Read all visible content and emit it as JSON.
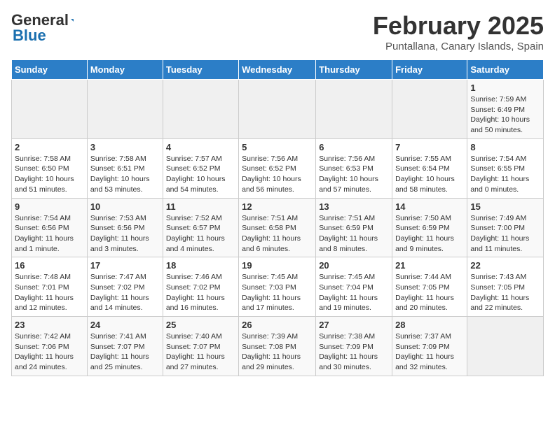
{
  "header": {
    "logo_general": "General",
    "logo_blue": "Blue",
    "month_title": "February 2025",
    "location": "Puntallana, Canary Islands, Spain"
  },
  "days_of_week": [
    "Sunday",
    "Monday",
    "Tuesday",
    "Wednesday",
    "Thursday",
    "Friday",
    "Saturday"
  ],
  "weeks": [
    [
      {
        "day": "",
        "text": ""
      },
      {
        "day": "",
        "text": ""
      },
      {
        "day": "",
        "text": ""
      },
      {
        "day": "",
        "text": ""
      },
      {
        "day": "",
        "text": ""
      },
      {
        "day": "",
        "text": ""
      },
      {
        "day": "1",
        "text": "Sunrise: 7:59 AM\nSunset: 6:49 PM\nDaylight: 10 hours and 50 minutes."
      }
    ],
    [
      {
        "day": "2",
        "text": "Sunrise: 7:58 AM\nSunset: 6:50 PM\nDaylight: 10 hours and 51 minutes."
      },
      {
        "day": "3",
        "text": "Sunrise: 7:58 AM\nSunset: 6:51 PM\nDaylight: 10 hours and 53 minutes."
      },
      {
        "day": "4",
        "text": "Sunrise: 7:57 AM\nSunset: 6:52 PM\nDaylight: 10 hours and 54 minutes."
      },
      {
        "day": "5",
        "text": "Sunrise: 7:56 AM\nSunset: 6:52 PM\nDaylight: 10 hours and 56 minutes."
      },
      {
        "day": "6",
        "text": "Sunrise: 7:56 AM\nSunset: 6:53 PM\nDaylight: 10 hours and 57 minutes."
      },
      {
        "day": "7",
        "text": "Sunrise: 7:55 AM\nSunset: 6:54 PM\nDaylight: 10 hours and 58 minutes."
      },
      {
        "day": "8",
        "text": "Sunrise: 7:54 AM\nSunset: 6:55 PM\nDaylight: 11 hours and 0 minutes."
      }
    ],
    [
      {
        "day": "9",
        "text": "Sunrise: 7:54 AM\nSunset: 6:56 PM\nDaylight: 11 hours and 1 minute."
      },
      {
        "day": "10",
        "text": "Sunrise: 7:53 AM\nSunset: 6:56 PM\nDaylight: 11 hours and 3 minutes."
      },
      {
        "day": "11",
        "text": "Sunrise: 7:52 AM\nSunset: 6:57 PM\nDaylight: 11 hours and 4 minutes."
      },
      {
        "day": "12",
        "text": "Sunrise: 7:51 AM\nSunset: 6:58 PM\nDaylight: 11 hours and 6 minutes."
      },
      {
        "day": "13",
        "text": "Sunrise: 7:51 AM\nSunset: 6:59 PM\nDaylight: 11 hours and 8 minutes."
      },
      {
        "day": "14",
        "text": "Sunrise: 7:50 AM\nSunset: 6:59 PM\nDaylight: 11 hours and 9 minutes."
      },
      {
        "day": "15",
        "text": "Sunrise: 7:49 AM\nSunset: 7:00 PM\nDaylight: 11 hours and 11 minutes."
      }
    ],
    [
      {
        "day": "16",
        "text": "Sunrise: 7:48 AM\nSunset: 7:01 PM\nDaylight: 11 hours and 12 minutes."
      },
      {
        "day": "17",
        "text": "Sunrise: 7:47 AM\nSunset: 7:02 PM\nDaylight: 11 hours and 14 minutes."
      },
      {
        "day": "18",
        "text": "Sunrise: 7:46 AM\nSunset: 7:02 PM\nDaylight: 11 hours and 16 minutes."
      },
      {
        "day": "19",
        "text": "Sunrise: 7:45 AM\nSunset: 7:03 PM\nDaylight: 11 hours and 17 minutes."
      },
      {
        "day": "20",
        "text": "Sunrise: 7:45 AM\nSunset: 7:04 PM\nDaylight: 11 hours and 19 minutes."
      },
      {
        "day": "21",
        "text": "Sunrise: 7:44 AM\nSunset: 7:05 PM\nDaylight: 11 hours and 20 minutes."
      },
      {
        "day": "22",
        "text": "Sunrise: 7:43 AM\nSunset: 7:05 PM\nDaylight: 11 hours and 22 minutes."
      }
    ],
    [
      {
        "day": "23",
        "text": "Sunrise: 7:42 AM\nSunset: 7:06 PM\nDaylight: 11 hours and 24 minutes."
      },
      {
        "day": "24",
        "text": "Sunrise: 7:41 AM\nSunset: 7:07 PM\nDaylight: 11 hours and 25 minutes."
      },
      {
        "day": "25",
        "text": "Sunrise: 7:40 AM\nSunset: 7:07 PM\nDaylight: 11 hours and 27 minutes."
      },
      {
        "day": "26",
        "text": "Sunrise: 7:39 AM\nSunset: 7:08 PM\nDaylight: 11 hours and 29 minutes."
      },
      {
        "day": "27",
        "text": "Sunrise: 7:38 AM\nSunset: 7:09 PM\nDaylight: 11 hours and 30 minutes."
      },
      {
        "day": "28",
        "text": "Sunrise: 7:37 AM\nSunset: 7:09 PM\nDaylight: 11 hours and 32 minutes."
      },
      {
        "day": "",
        "text": ""
      }
    ]
  ]
}
